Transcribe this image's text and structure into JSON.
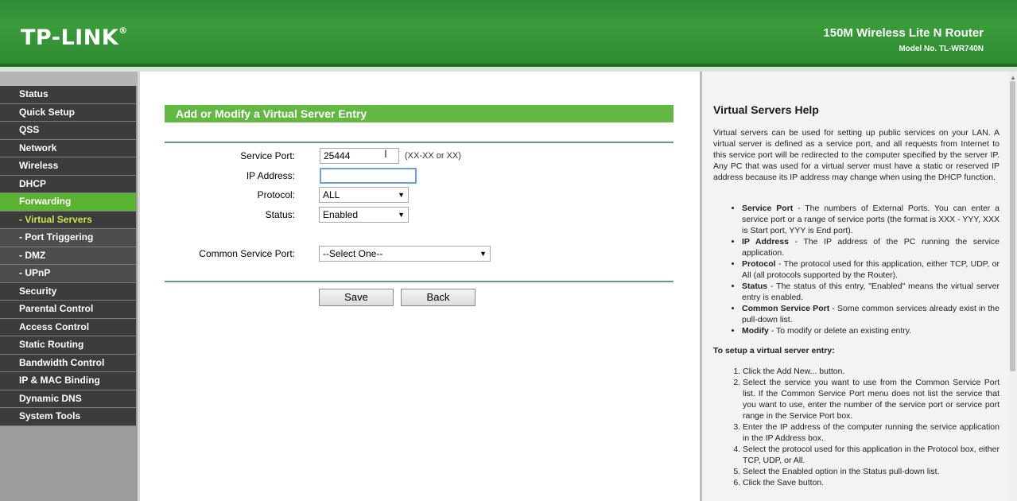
{
  "header": {
    "logo": "TP-LINK",
    "logo_mark": "®",
    "product": "150M Wireless Lite N Router",
    "model": "Model No. TL-WR740N"
  },
  "sidebar": {
    "items": [
      {
        "label": "Status",
        "sub": false,
        "active": false
      },
      {
        "label": "Quick Setup",
        "sub": false,
        "active": false
      },
      {
        "label": "QSS",
        "sub": false,
        "active": false
      },
      {
        "label": "Network",
        "sub": false,
        "active": false
      },
      {
        "label": "Wireless",
        "sub": false,
        "active": false
      },
      {
        "label": "DHCP",
        "sub": false,
        "active": false
      },
      {
        "label": "Forwarding",
        "sub": false,
        "active": true
      },
      {
        "label": "- Virtual Servers",
        "sub": true,
        "active": true
      },
      {
        "label": "- Port Triggering",
        "sub": true,
        "active": false
      },
      {
        "label": "- DMZ",
        "sub": true,
        "active": false
      },
      {
        "label": "- UPnP",
        "sub": true,
        "active": false
      },
      {
        "label": "Security",
        "sub": false,
        "active": false
      },
      {
        "label": "Parental Control",
        "sub": false,
        "active": false
      },
      {
        "label": "Access Control",
        "sub": false,
        "active": false
      },
      {
        "label": "Static Routing",
        "sub": false,
        "active": false
      },
      {
        "label": "Bandwidth Control",
        "sub": false,
        "active": false
      },
      {
        "label": "IP & MAC Binding",
        "sub": false,
        "active": false
      },
      {
        "label": "Dynamic DNS",
        "sub": false,
        "active": false
      },
      {
        "label": "System Tools",
        "sub": false,
        "active": false
      }
    ]
  },
  "form": {
    "title": "Add or Modify a Virtual Server Entry",
    "service_port_label": "Service Port:",
    "service_port_value": "25444",
    "service_port_hint": "(XX-XX or XX)",
    "ip_label": "IP Address:",
    "ip_value": "",
    "protocol_label": "Protocol:",
    "protocol_value": "ALL",
    "status_label": "Status:",
    "status_value": "Enabled",
    "common_label": "Common Service Port:",
    "common_value": "--Select One--",
    "save_label": "Save",
    "back_label": "Back"
  },
  "help": {
    "title": "Virtual Servers Help",
    "intro": "Virtual servers can be used for setting up public services on your LAN. A virtual server is defined as a service port, and all requests from Internet to this service port will be redirected to the computer specified by the server IP. Any PC that was used for a virtual server must have a static or reserved IP address because its IP address may change when using the DHCP function.",
    "bullets": [
      {
        "term": "Service Port",
        "text": " - The numbers of External Ports. You can enter a service port or a range of service ports (the format is XXX - YYY, XXX is Start port, YYY is End port)."
      },
      {
        "term": "IP Address",
        "text": " - The IP address of the PC running the service application."
      },
      {
        "term": "Protocol",
        "text": " - The protocol used for this application, either TCP, UDP, or All (all protocols supported by the Router)."
      },
      {
        "term": "Status",
        "text": " - The status of this entry, \"Enabled\" means the virtual server entry is enabled."
      },
      {
        "term": "Common Service Port",
        "text": " - Some common services already exist in the pull-down list."
      },
      {
        "term": "Modify",
        "text": " - To modify or delete an existing entry."
      }
    ],
    "setup_title": "To setup a virtual server entry:",
    "steps": [
      "Click the Add New... button.",
      "Select the service you want to use from the Common Service Port list. If the Common Service Port menu does not list the service that you want to use, enter the number of the service port or service port range in the Service Port box.",
      "Enter the IP address of the computer running the service application in the IP Address box.",
      "Select the protocol used for this application in the Protocol box, either TCP, UDP, or All.",
      "Select the Enabled option in the Status pull-down list.",
      "Click the Save button."
    ]
  },
  "colors": {
    "header_green": "#3a9b3a",
    "active_green": "#5bb332",
    "title_bar_green": "#63b843",
    "sub_active_text": "#c9e84a",
    "nav_dark": "#3c3c3c"
  }
}
